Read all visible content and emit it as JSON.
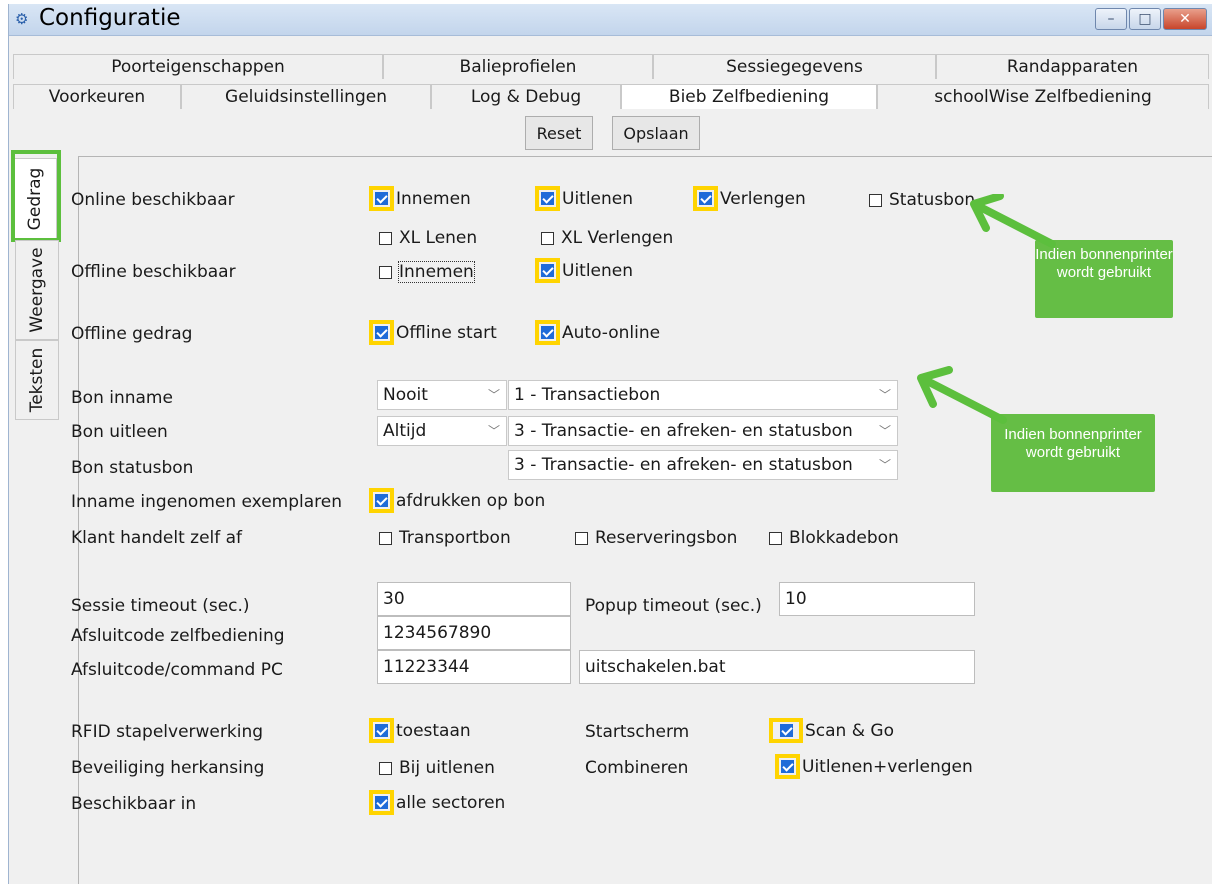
{
  "window": {
    "title": "Configuratie",
    "minimize": "–",
    "maximize": "□",
    "close": "✕",
    "app_icon": "gears-icon"
  },
  "tabs_row1": [
    "Poorteigenschappen",
    "Balieprofielen",
    "Sessiegegevens",
    "Randapparaten"
  ],
  "tabs_row2": [
    "Voorkeuren",
    "Geluidsinstellingen",
    "Log & Debug",
    "Bieb Zelfbediening",
    "schoolWise Zelfbediening"
  ],
  "toolbar": {
    "reset": "Reset",
    "save": "Opslaan"
  },
  "side_tabs": [
    "Gedrag",
    "Weergave",
    "Teksten"
  ],
  "online": {
    "label": "Online beschikbaar",
    "innemen": "Innemen",
    "uitlenen": "Uitlenen",
    "verlengen": "Verlengen",
    "statusbon": "Statusbon",
    "xl_lenen": "XL Lenen",
    "xl_verlengen": "XL Verlengen"
  },
  "offline": {
    "label": "Offline beschikbaar",
    "innemen": "Innemen",
    "uitlenen": "Uitlenen"
  },
  "offline_gedrag": {
    "label": "Offline gedrag",
    "start": "Offline start",
    "auto": "Auto-online"
  },
  "bon": {
    "inname_label": "Bon inname",
    "inname_when": "Nooit",
    "inname_type": "1 - Transactiebon",
    "uitleen_label": "Bon uitleen",
    "uitleen_when": "Altijd",
    "uitleen_type": "3 - Transactie- en afreken- en statusbon",
    "status_label": "Bon statusbon",
    "status_type": "3 - Transactie- en afreken- en statusbon"
  },
  "inname_ingenomen": {
    "label": "Inname ingenomen exemplaren",
    "option": "afdrukken op bon"
  },
  "klant": {
    "label": "Klant handelt zelf af",
    "transport": "Transportbon",
    "reservering": "Reserveringsbon",
    "blokkade": "Blokkadebon"
  },
  "timeouts": {
    "session_label": "Sessie timeout (sec.)",
    "session_value": "30",
    "popup_label": "Popup timeout (sec.)",
    "popup_value": "10"
  },
  "afsluit": {
    "zelf_label": "Afsluitcode zelfbediening",
    "zelf_value": "1234567890",
    "pc_label": "Afsluitcode/command PC",
    "pc_value": "11223344",
    "command_value": "uitschakelen.bat"
  },
  "rfid": {
    "label": "RFID stapelverwerking",
    "option": "toestaan",
    "start_label": "Startscherm",
    "start_option": "Scan & Go"
  },
  "beveiliging": {
    "label": "Beveiliging herkansing",
    "option": "Bij uitlenen",
    "comb_label": "Combineren",
    "comb_option": "Uitlenen+verlengen"
  },
  "beschikbaar": {
    "label": "Beschikbaar in",
    "option": "alle sectoren"
  },
  "callouts": {
    "text1": "Indien bonnenprinter wordt gebruikt",
    "text2": "Indien bonnenprinter wordt gebruikt"
  },
  "colors": {
    "highlight": "#ffd400",
    "callout": "#65be45",
    "checkbox": "#1f6bd8"
  }
}
